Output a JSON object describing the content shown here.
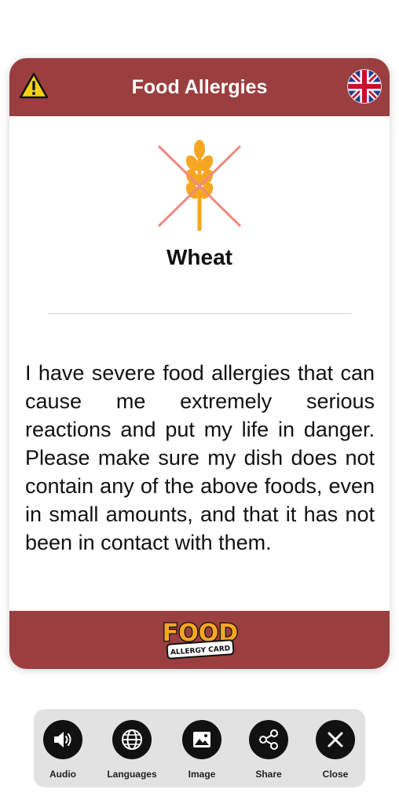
{
  "colors": {
    "brand": "#9b3e3f",
    "warning": "#f5d312",
    "wheat": "#f5a623",
    "cross": "#f08a82"
  },
  "card": {
    "title": "Food Allergies",
    "warning_icon": "warning-icon",
    "language_flag_icon": "uk-flag-icon",
    "allergen": {
      "name": "Wheat",
      "icon": "wheat-crossed-icon"
    },
    "message": "I have severe food allergies that can cause me extremely serious reactions and put my life in danger. Please make sure my dish does not contain any of the above foods, even in small amounts, and that it has not been in contact with them.",
    "footer_logo": {
      "line1": "FOOD",
      "line2": "ALLERGY CARD"
    }
  },
  "toolbar": {
    "items": [
      {
        "label": "Audio",
        "icon": "speaker-icon"
      },
      {
        "label": "Languages",
        "icon": "globe-icon"
      },
      {
        "label": "Image",
        "icon": "image-icon"
      },
      {
        "label": "Share",
        "icon": "share-icon"
      },
      {
        "label": "Close",
        "icon": "close-icon"
      }
    ]
  }
}
